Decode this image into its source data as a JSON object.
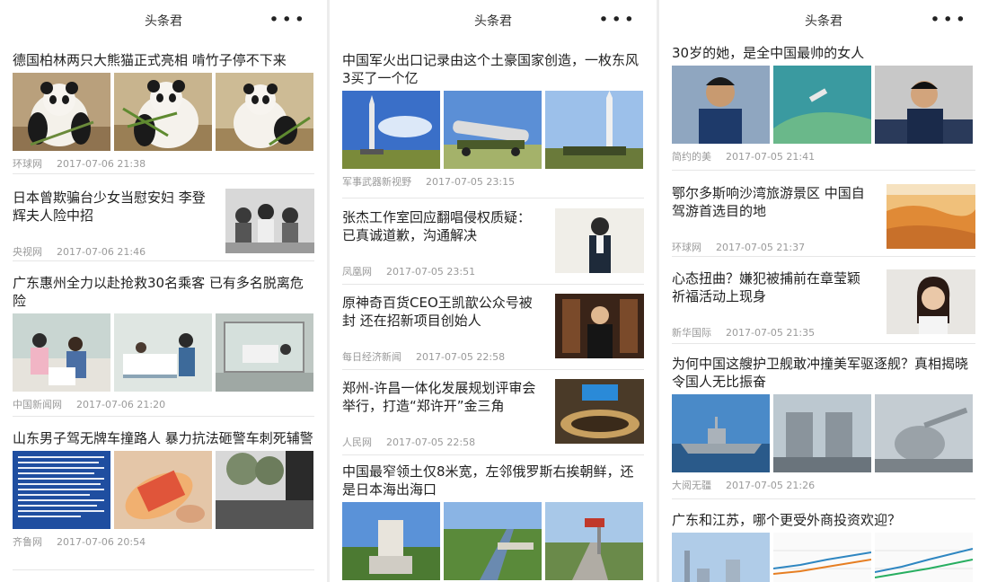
{
  "panels": [
    {
      "title": "头条君",
      "more": "•••",
      "items": [
        {
          "headline": "德国柏林两只大熊猫正式亮相 啃竹子停不下来",
          "source": "环球网",
          "time": "2017-07-06 21:38"
        },
        {
          "headline": "日本曾欺骗台少女当慰安妇 李登辉夫人险中招",
          "source": "央视网",
          "time": "2017-07-06 21:46"
        },
        {
          "headline": "广东惠州全力以赴抢救30名乘客 已有多名脱离危险",
          "source": "中国新闻网",
          "time": "2017-07-06 21:20"
        },
        {
          "headline": "山东男子驾无牌车撞路人 暴力抗法砸警车刺死辅警",
          "source": "齐鲁网",
          "time": "2017-07-06 20:54"
        }
      ]
    },
    {
      "title": "头条君",
      "more": "•••",
      "items": [
        {
          "headline": "中国军火出口记录由这个土豪国家创造，一枚东风3买了一个亿",
          "source": "军事武器新视野",
          "time": "2017-07-05 23:15"
        },
        {
          "headline": "张杰工作室回应翻唱侵权质疑：已真诚道歉，沟通解决",
          "source": "凤凰网",
          "time": "2017-07-05 23:51"
        },
        {
          "headline": "原神奇百货CEO王凯歆公众号被封 还在招新项目创始人",
          "source": "每日经济新闻",
          "time": "2017-07-05 22:58"
        },
        {
          "headline": "郑州-许昌一体化发展规划评审会举行，打造“郑许开”金三角",
          "source": "人民网",
          "time": "2017-07-05 22:58"
        },
        {
          "headline": "中国最窄领土仅8米宽，左邻俄罗斯右挨朝鲜，还是日本海出海口"
        }
      ]
    },
    {
      "title": "头条君",
      "more": "•••",
      "items": [
        {
          "headline": "30岁的她，是全中国最帅的女人",
          "source": "简约的美",
          "time": "2017-07-05 21:41"
        },
        {
          "headline": "鄂尔多斯响沙湾旅游景区 中国自驾游首选目的地",
          "source": "环球网",
          "time": "2017-07-05 21:37"
        },
        {
          "headline": "心态扭曲？嫌犯被捕前在章莹颖祈福活动上现身",
          "source": "新华国际",
          "time": "2017-07-05 21:35"
        },
        {
          "headline": "为何中国这艘护卫舰敢冲撞美军驱逐舰？真相揭晓令国人无比振奋",
          "source": "大阅无疆",
          "time": "2017-07-05 21:26"
        },
        {
          "headline": "广东和江苏，哪个更受外商投资欢迎？"
        }
      ]
    }
  ]
}
